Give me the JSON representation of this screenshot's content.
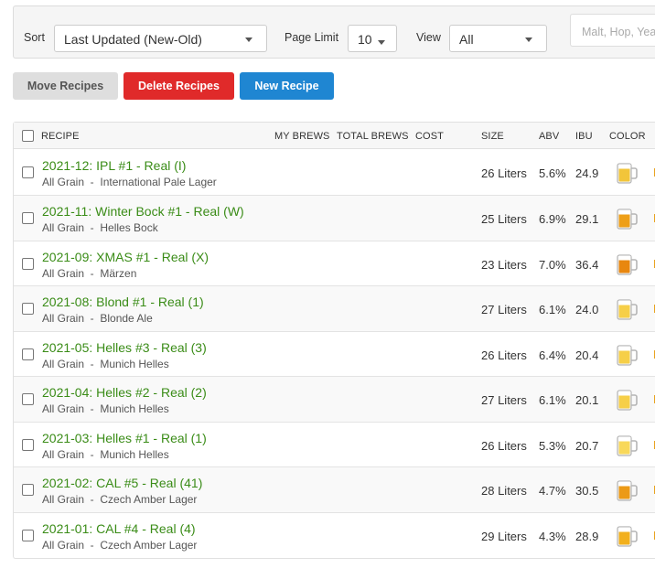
{
  "filters": {
    "sort_label": "Sort",
    "sort_value": "Last Updated (New-Old)",
    "page_limit_label": "Page Limit",
    "page_limit_value": "10",
    "view_label": "View",
    "view_value": "All",
    "search_placeholder": "Malt, Hop, Yeast"
  },
  "actions": {
    "move": "Move Recipes",
    "delete": "Delete Recipes",
    "new": "New Recipe"
  },
  "colors": {
    "link_green": "#3a8c17",
    "delete_red": "#e02a2a",
    "new_blue": "#1f86d2",
    "beer_gold": "#f2b01d"
  },
  "table": {
    "headers": {
      "recipe": "RECIPE",
      "my_brews": "MY BREWS",
      "total_brews": "TOTAL BREWS",
      "cost": "COST",
      "size": "SIZE",
      "abv": "ABV",
      "ibu": "IBU",
      "color": "COLOR"
    },
    "rows": [
      {
        "name": "2021-12: IPL #1 - Real (I)",
        "method": "All Grain",
        "style": "International Pale Lager",
        "size": "26 Liters",
        "abv": "5.6%",
        "ibu": "24.9",
        "color_icon": "beer-mug-icon"
      },
      {
        "name": "2021-11: Winter Bock #1 - Real (W)",
        "method": "All Grain",
        "style": "Helles Bock",
        "size": "25 Liters",
        "abv": "6.9%",
        "ibu": "29.1",
        "color_icon": "beer-mug-icon"
      },
      {
        "name": "2021-09: XMAS #1 - Real (X)",
        "method": "All Grain",
        "style": "Märzen",
        "size": "23 Liters",
        "abv": "7.0%",
        "ibu": "36.4",
        "color_icon": "beer-mug-icon"
      },
      {
        "name": "2021-08: Blond #1 - Real (1)",
        "method": "All Grain",
        "style": "Blonde Ale",
        "size": "27 Liters",
        "abv": "6.1%",
        "ibu": "24.0",
        "color_icon": "beer-mug-icon"
      },
      {
        "name": "2021-05: Helles #3 - Real (3)",
        "method": "All Grain",
        "style": "Munich Helles",
        "size": "26 Liters",
        "abv": "6.4%",
        "ibu": "20.4",
        "color_icon": "beer-mug-icon"
      },
      {
        "name": "2021-04: Helles #2 - Real (2)",
        "method": "All Grain",
        "style": "Munich Helles",
        "size": "27 Liters",
        "abv": "6.1%",
        "ibu": "20.1",
        "color_icon": "beer-mug-icon"
      },
      {
        "name": "2021-03: Helles #1 - Real (1)",
        "method": "All Grain",
        "style": "Munich Helles",
        "size": "26 Liters",
        "abv": "5.3%",
        "ibu": "20.7",
        "color_icon": "beer-mug-icon"
      },
      {
        "name": "2021-02: CAL #5 - Real (41)",
        "method": "All Grain",
        "style": "Czech Amber Lager",
        "size": "28 Liters",
        "abv": "4.7%",
        "ibu": "30.5",
        "color_icon": "beer-mug-icon"
      },
      {
        "name": "2021-01: CAL #4 - Real (4)",
        "method": "All Grain",
        "style": "Czech Amber Lager",
        "size": "29 Liters",
        "abv": "4.3%",
        "ibu": "28.9",
        "color_icon": "beer-mug-icon"
      }
    ]
  }
}
